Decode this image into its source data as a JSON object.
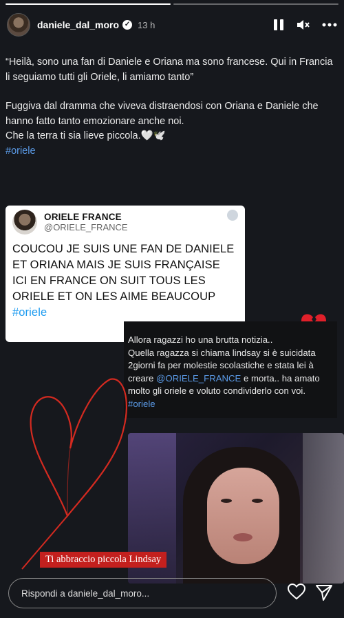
{
  "header": {
    "username": "daniele_dal_moro",
    "time": "13 h",
    "icons": [
      "pause-icon",
      "mute-icon",
      "more-icon",
      "verified-badge-icon"
    ]
  },
  "caption": {
    "quote": "“Heilà, sono una fan di Daniele e Oriana ma sono francese. Qui in Francia li seguiamo tutti gli Oriele, li amiamo tanto”",
    "body": "Fuggiva dal dramma che viveva distraendosi con Oriana e Daniele che hanno fatto tanto emozionare anche noi.",
    "closing": "Che la terra ti sia lieve piccola.🤍🕊️",
    "hashtag": "#oriele"
  },
  "tweet": {
    "name": "ORIELE FRANCE",
    "handle": "@ORIELE_FRANCE",
    "text": "COUCOU JE SUIS UNE FAN DE DANIELE ET ORIANA MAIS JE SUIS FRANÇAISE\nICI EN FRANCE ON SUIT TOUS LES ORIELE ET ON LES AIME BEAUCOUP",
    "hashtag": "#oriele"
  },
  "notice": {
    "line1": "Allora ragazzi ho una brutta notizia..",
    "text_before": "Quella ragazza si chiama lindsay si è suicidata 2giorni fa per molestie scolastiche e stata lei à creare ",
    "mention": "@ORIELE_FRANCE",
    "text_after": " e morta.. ha amato molto gli oriele e voluto condividerlo con voi.",
    "hashtag": "#oriele"
  },
  "sticker": {
    "text": "Ti abbraccio piccola Lindsay"
  },
  "reply": {
    "placeholder": "Rispondi a daniele_dal_moro..."
  },
  "colors": {
    "background": "#16181d",
    "link": "#5b9be8",
    "sticker": "#c3201e",
    "scribble": "#d42a20"
  }
}
